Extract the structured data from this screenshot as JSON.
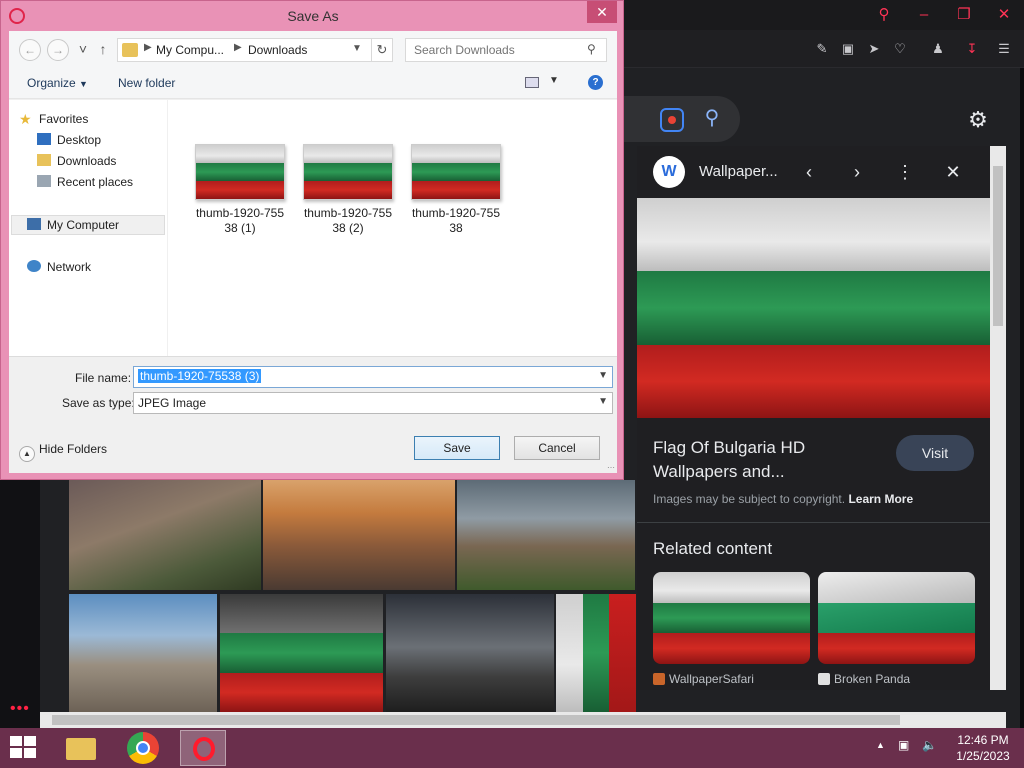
{
  "dialog": {
    "title": "Save As",
    "address": {
      "segments": [
        "My Compu...",
        "Downloads"
      ]
    },
    "search_placeholder": "Search Downloads",
    "commands": {
      "organize": "Organize",
      "new_folder": "New folder"
    },
    "nav_pane": {
      "favorites": "Favorites",
      "desktop": "Desktop",
      "downloads": "Downloads",
      "recent_places": "Recent places",
      "my_computer": "My Computer",
      "network": "Network"
    },
    "files": [
      {
        "line1": "thumb-1920-755",
        "line2": "38 (1)"
      },
      {
        "line1": "thumb-1920-755",
        "line2": "38 (2)"
      },
      {
        "line1": "thumb-1920-755",
        "line2": "38"
      }
    ],
    "file_name_label": "File name:",
    "file_name_value": "thumb-1920-75538 (3)",
    "save_type_label": "Save as type:",
    "save_type_value": "JPEG Image",
    "hide_folders": "Hide Folders",
    "save_button": "Save",
    "cancel_button": "Cancel"
  },
  "preview": {
    "source": "Wallpaper...",
    "title": "Flag Of Bulgaria HD Wallpapers and...",
    "visit_button": "Visit",
    "note_prefix": "Images may be subject to copyright.",
    "note_link": "Learn More",
    "related_heading": "Related content",
    "related": [
      {
        "source": "WallpaperSafari"
      },
      {
        "source": "Broken Panda"
      }
    ]
  },
  "taskbar": {
    "time": "12:46 PM",
    "date": "1/25/2023"
  },
  "colors": {
    "dialog_frame": "#e992b6",
    "opera_red": "#ff1b2d",
    "taskbar": "#6a2f4c",
    "flag_white": "#e0e0e0",
    "flag_green": "#2d8f50",
    "flag_red": "#c91f1f"
  }
}
